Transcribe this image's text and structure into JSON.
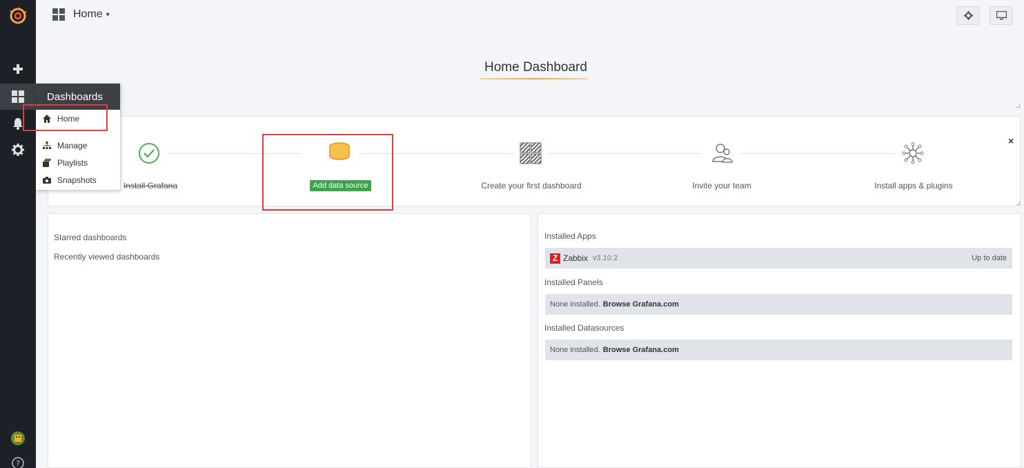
{
  "topbar": {
    "title": "Home"
  },
  "home": {
    "title": "Home Dashboard"
  },
  "menu": {
    "header": "Dashboards",
    "items": [
      {
        "label": "Home",
        "icon": "home-icon"
      },
      {
        "label": "Manage",
        "icon": "sitemap-icon"
      },
      {
        "label": "Playlists",
        "icon": "film-icon"
      },
      {
        "label": "Snapshots",
        "icon": "camera-icon"
      }
    ]
  },
  "progress": {
    "steps": [
      {
        "label": "Install Grafana",
        "state": "done"
      },
      {
        "label": "Add data source",
        "state": "active"
      },
      {
        "label": "Create your first dashboard",
        "state": "todo"
      },
      {
        "label": "Invite your team",
        "state": "todo"
      },
      {
        "label": "Install apps & plugins",
        "state": "todo"
      }
    ],
    "close": "×"
  },
  "left_panel": {
    "starred": "Starred dashboards",
    "recent": "Recently viewed dashboards"
  },
  "right_panel": {
    "apps_title": "Installed Apps",
    "app": {
      "name": "Zabbix",
      "version": "v3.10.2",
      "status": "Up to date",
      "logo_letter": "Z"
    },
    "panels_title": "Installed Panels",
    "panels_none": "None installed.",
    "panels_link": "Browse Grafana.com",
    "datasources_title": "Installed Datasources",
    "datasources_none": "None installed.",
    "datasources_link": "Browse Grafana.com"
  },
  "colors": {
    "accent_green": "#3aa64c",
    "highlight_red": "#e33b3b",
    "brand_orange": "#f4a442",
    "sidebar_bg": "#1e2028"
  }
}
